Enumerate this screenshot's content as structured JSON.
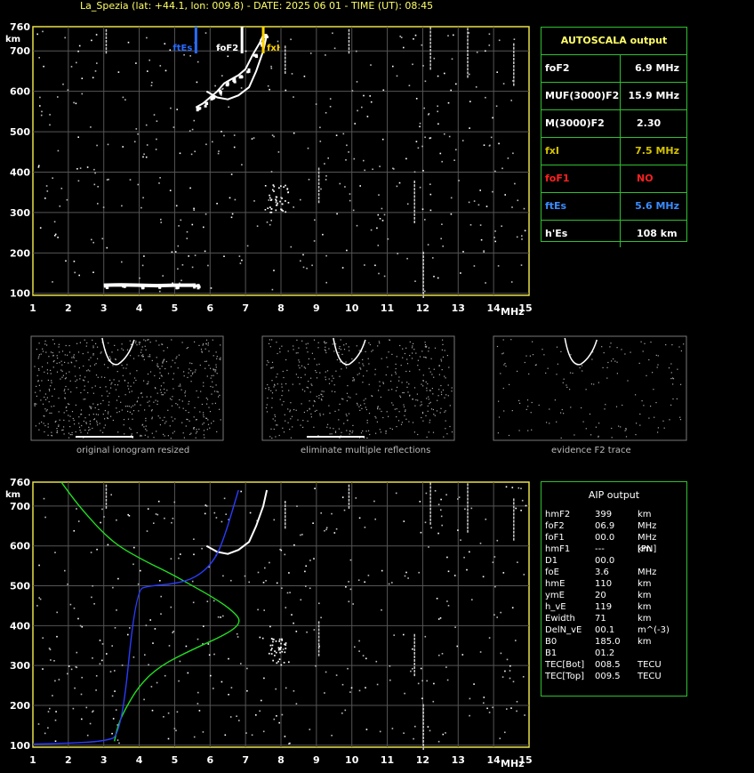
{
  "header": {
    "title": "La_Spezia (lat: +44.1, lon: 009.8) - DATE: 2025 06 01 - TIME (UT): 08:45"
  },
  "autoscala": {
    "title": "AUTOSCALA output",
    "rows": [
      {
        "label": "foF2",
        "value": "6.9 MHz",
        "color": "#ffffff",
        "label_color": "#ffffff"
      },
      {
        "label": "MUF(3000)F2",
        "value": "15.9 MHz",
        "color": "#ffffff",
        "label_color": "#ffffff"
      },
      {
        "label": "M(3000)F2",
        "value": "2.30",
        "color": "#ffffff",
        "label_color": "#ffffff"
      },
      {
        "label": "fxI",
        "value": "7.5 MHz",
        "color": "#d4c200",
        "label_color": "#d4c200"
      },
      {
        "label": "foF1",
        "value": "NO",
        "color": "#ff2020",
        "label_color": "#ff2020"
      },
      {
        "label": "ftEs",
        "value": "5.6 MHz",
        "color": "#3a8cff",
        "label_color": "#3a8cff"
      },
      {
        "label": "h'Es",
        "value": "108     km",
        "color": "#ffffff",
        "label_color": "#ffffff"
      }
    ]
  },
  "aip": {
    "title": "AIP output",
    "rows": [
      {
        "k": "hmF2",
        "v": "399",
        "u": "km"
      },
      {
        "k": "foF2",
        "v": "06.9",
        "u": "MHz"
      },
      {
        "k": "foF1",
        "v": "00.0",
        "u": "MHz   [PN]"
      },
      {
        "k": "hmF1",
        "v": "---",
        "u": "km"
      },
      {
        "k": "D1",
        "v": "00.0",
        "u": ""
      },
      {
        "k": "foE",
        "v": "3.6",
        "u": "MHz"
      },
      {
        "k": "hmE",
        "v": "110",
        "u": "km"
      },
      {
        "k": "ymE",
        "v": "20",
        "u": "km"
      },
      {
        "k": "h_vE",
        "v": "119",
        "u": "km"
      },
      {
        "k": "Ewidth",
        "v": "71",
        "u": "km"
      },
      {
        "k": "DelN_vE",
        "v": "00.1",
        "u": "m^(-3)"
      },
      {
        "k": "B0",
        "v": "185.0",
        "u": "km"
      },
      {
        "k": "B1",
        "v": "01.2",
        "u": ""
      },
      {
        "k": "TEC[Bot]",
        "v": "008.5",
        "u": "TECU"
      },
      {
        "k": "TEC[Top]",
        "v": "009.5",
        "u": "TECU"
      }
    ]
  },
  "captions": {
    "original": "original ionogram resized",
    "eliminate": "eliminate multiple reflections",
    "evidence": "evidence F2 trace"
  },
  "axis": {
    "x_ticks": [
      "1",
      "2",
      "3",
      "4",
      "5",
      "6",
      "7",
      "8",
      "9",
      "10",
      "11",
      "12",
      "13",
      "14",
      "15"
    ],
    "x_unit": "MHz",
    "y_ticks": [
      "100",
      "200",
      "300",
      "400",
      "500",
      "600",
      "700"
    ],
    "y_top": "760",
    "y_unit": "km"
  },
  "markers": {
    "ftEs": {
      "label": "ftEs",
      "freq": 5.6,
      "color": "#2a6cff"
    },
    "foF2": {
      "label": "foF2",
      "freq": 6.9,
      "color": "#ffffff"
    },
    "fxI": {
      "label": "fxI",
      "freq": 7.5,
      "color": "#ffd400"
    }
  },
  "chart_data": [
    {
      "type": "scatter",
      "title": "La_Spezia (lat: +44.1, lon: 009.8) - DATE: 2025 06 01 - TIME (UT): 08:45",
      "xlabel": "MHz",
      "ylabel": "km",
      "xlim": [
        1,
        15
      ],
      "ylim": [
        95,
        760
      ],
      "grid": true,
      "series": [
        {
          "name": "F2 trace",
          "x": [
            5.6,
            5.8,
            6.0,
            6.2,
            6.4,
            6.6,
            6.8,
            7.0,
            7.2,
            7.4,
            7.5
          ],
          "y": [
            560,
            570,
            585,
            600,
            620,
            630,
            640,
            655,
            690,
            720,
            740
          ]
        },
        {
          "name": "Es trace",
          "x": [
            3.0,
            3.5,
            4.0,
            4.5,
            5.0,
            5.5,
            5.6
          ],
          "y": [
            120,
            121,
            120,
            119,
            120,
            120,
            120
          ]
        }
      ]
    },
    {
      "type": "line",
      "title": "AIP output",
      "xlabel": "MHz",
      "ylabel": "km",
      "xlim": [
        1,
        15
      ],
      "ylim": [
        95,
        760
      ],
      "series": [
        {
          "name": "profile",
          "x": [
            1.8,
            2.3,
            2.9,
            3.4,
            4.2,
            4.9,
            5.5,
            6.1,
            6.6,
            6.9,
            6.5,
            5.5,
            4.6,
            4.0,
            3.6,
            3.4,
            3.3
          ],
          "y": [
            760,
            700,
            640,
            600,
            560,
            530,
            500,
            470,
            440,
            410,
            380,
            340,
            300,
            250,
            190,
            150,
            110
          ]
        },
        {
          "name": "virtual height",
          "x": [
            1.0,
            2.0,
            3.0,
            3.5,
            3.9,
            4.3,
            5.0,
            5.6,
            6.1,
            6.4,
            6.8
          ],
          "y": [
            103,
            105,
            110,
            125,
            490,
            500,
            505,
            520,
            560,
            620,
            740
          ]
        }
      ]
    }
  ]
}
